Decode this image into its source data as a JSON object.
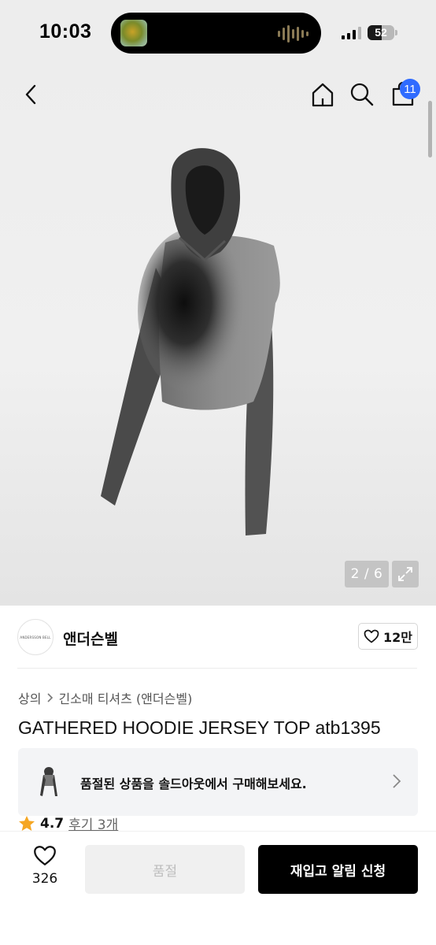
{
  "status_bar": {
    "time": "10:03",
    "battery": "52",
    "battery_level": 0.52
  },
  "nav": {
    "icons": [
      "back-chevron-icon",
      "home-icon",
      "search-icon",
      "shopping-bag-icon"
    ],
    "cart_count": "11"
  },
  "gallery": {
    "indicator": "2 / 6",
    "current": 2,
    "total": 6
  },
  "brand": {
    "name": "앤더슨벨",
    "logo_text": "ANDERSSON BELL",
    "likes": "12만"
  },
  "breadcrumb": {
    "category": "상의",
    "subcategory": "긴소매 티셔츠 (앤더슨벨)"
  },
  "product": {
    "title": "GATHERED HOODIE JERSEY TOP atb1395"
  },
  "soldout_banner": {
    "text": "품절된 상품을 솔드아웃에서 구매해보세요."
  },
  "rating": {
    "score": "4.7",
    "reviews": "후기 3개"
  },
  "bottom_bar": {
    "wish_count": "326",
    "soldout_label": "품절",
    "restock_label": "재입고 알림 신청"
  },
  "colors": {
    "accent_badge": "#2f6bff",
    "primary_button": "#000000",
    "star": "#f5a623"
  }
}
